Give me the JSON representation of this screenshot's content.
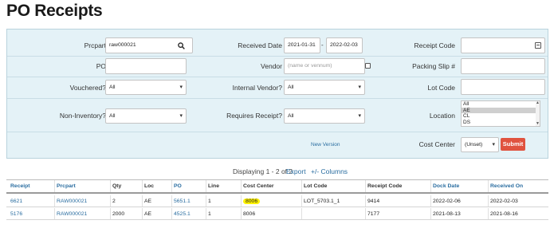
{
  "page": {
    "title": "PO Receipts"
  },
  "filters": {
    "prcpart": {
      "label": "Prcpart",
      "value": "raw000021"
    },
    "received_date": {
      "label": "Received Date",
      "from": "2021-01-31",
      "to": "2022-02-03",
      "separator": "-"
    },
    "receipt_code": {
      "label": "Receipt Code",
      "value": ""
    },
    "po": {
      "label": "PO",
      "value": ""
    },
    "vendor": {
      "label": "Vendor",
      "placeholder": "(name or vennum)"
    },
    "packing_slip": {
      "label": "Packing Slip #",
      "value": ""
    },
    "vouchered": {
      "label": "Vouchered?",
      "selected": "All"
    },
    "internal_vendor": {
      "label": "Internal Vendor?",
      "selected": "All"
    },
    "lot_code": {
      "label": "Lot Code",
      "value": ""
    },
    "non_inventory": {
      "label": "Non-Inventory?",
      "selected": "All"
    },
    "requires_receipt": {
      "label": "Requires Receipt?",
      "selected": "All"
    },
    "location": {
      "label": "Location",
      "options": [
        "All",
        "AE",
        "CL",
        "DS"
      ],
      "selected": "AE"
    },
    "new_version_link": "New Version",
    "cost_center": {
      "label": "Cost Center",
      "selected": "(Unset)"
    },
    "submit_label": "Submit"
  },
  "results": {
    "summary": "Displaying 1 - 2 of 2",
    "export_label": "Export",
    "columns_label": "+/- Columns"
  },
  "table": {
    "headers": [
      "Receipt",
      "Prcpart",
      "Qty",
      "Loc",
      "PO",
      "Line",
      "Cost Center",
      "Lot Code",
      "Receipt Code",
      "Dock Date",
      "Received On"
    ],
    "rows": [
      {
        "receipt": "6621",
        "prcpart": "RAW000021",
        "qty": "2",
        "loc": "AE",
        "po": "5651.1",
        "line": "1",
        "cost_center": "8006",
        "lot_code": "LOT_5703.1_1",
        "receipt_code": "9414",
        "dock_date": "2022-02-06",
        "received_on": "2022-02-03"
      },
      {
        "receipt": "5176",
        "prcpart": "RAW000021",
        "qty": "2000",
        "loc": "AE",
        "po": "4525.1",
        "line": "1",
        "cost_center": "8006",
        "lot_code": "",
        "receipt_code": "7177",
        "dock_date": "2021-08-13",
        "received_on": "2021-08-16"
      }
    ]
  },
  "colors": {
    "panel_bg": "#e4f2f7",
    "link": "#2a6da0",
    "submit": "#e0533f",
    "highlight": "#fff200"
  }
}
